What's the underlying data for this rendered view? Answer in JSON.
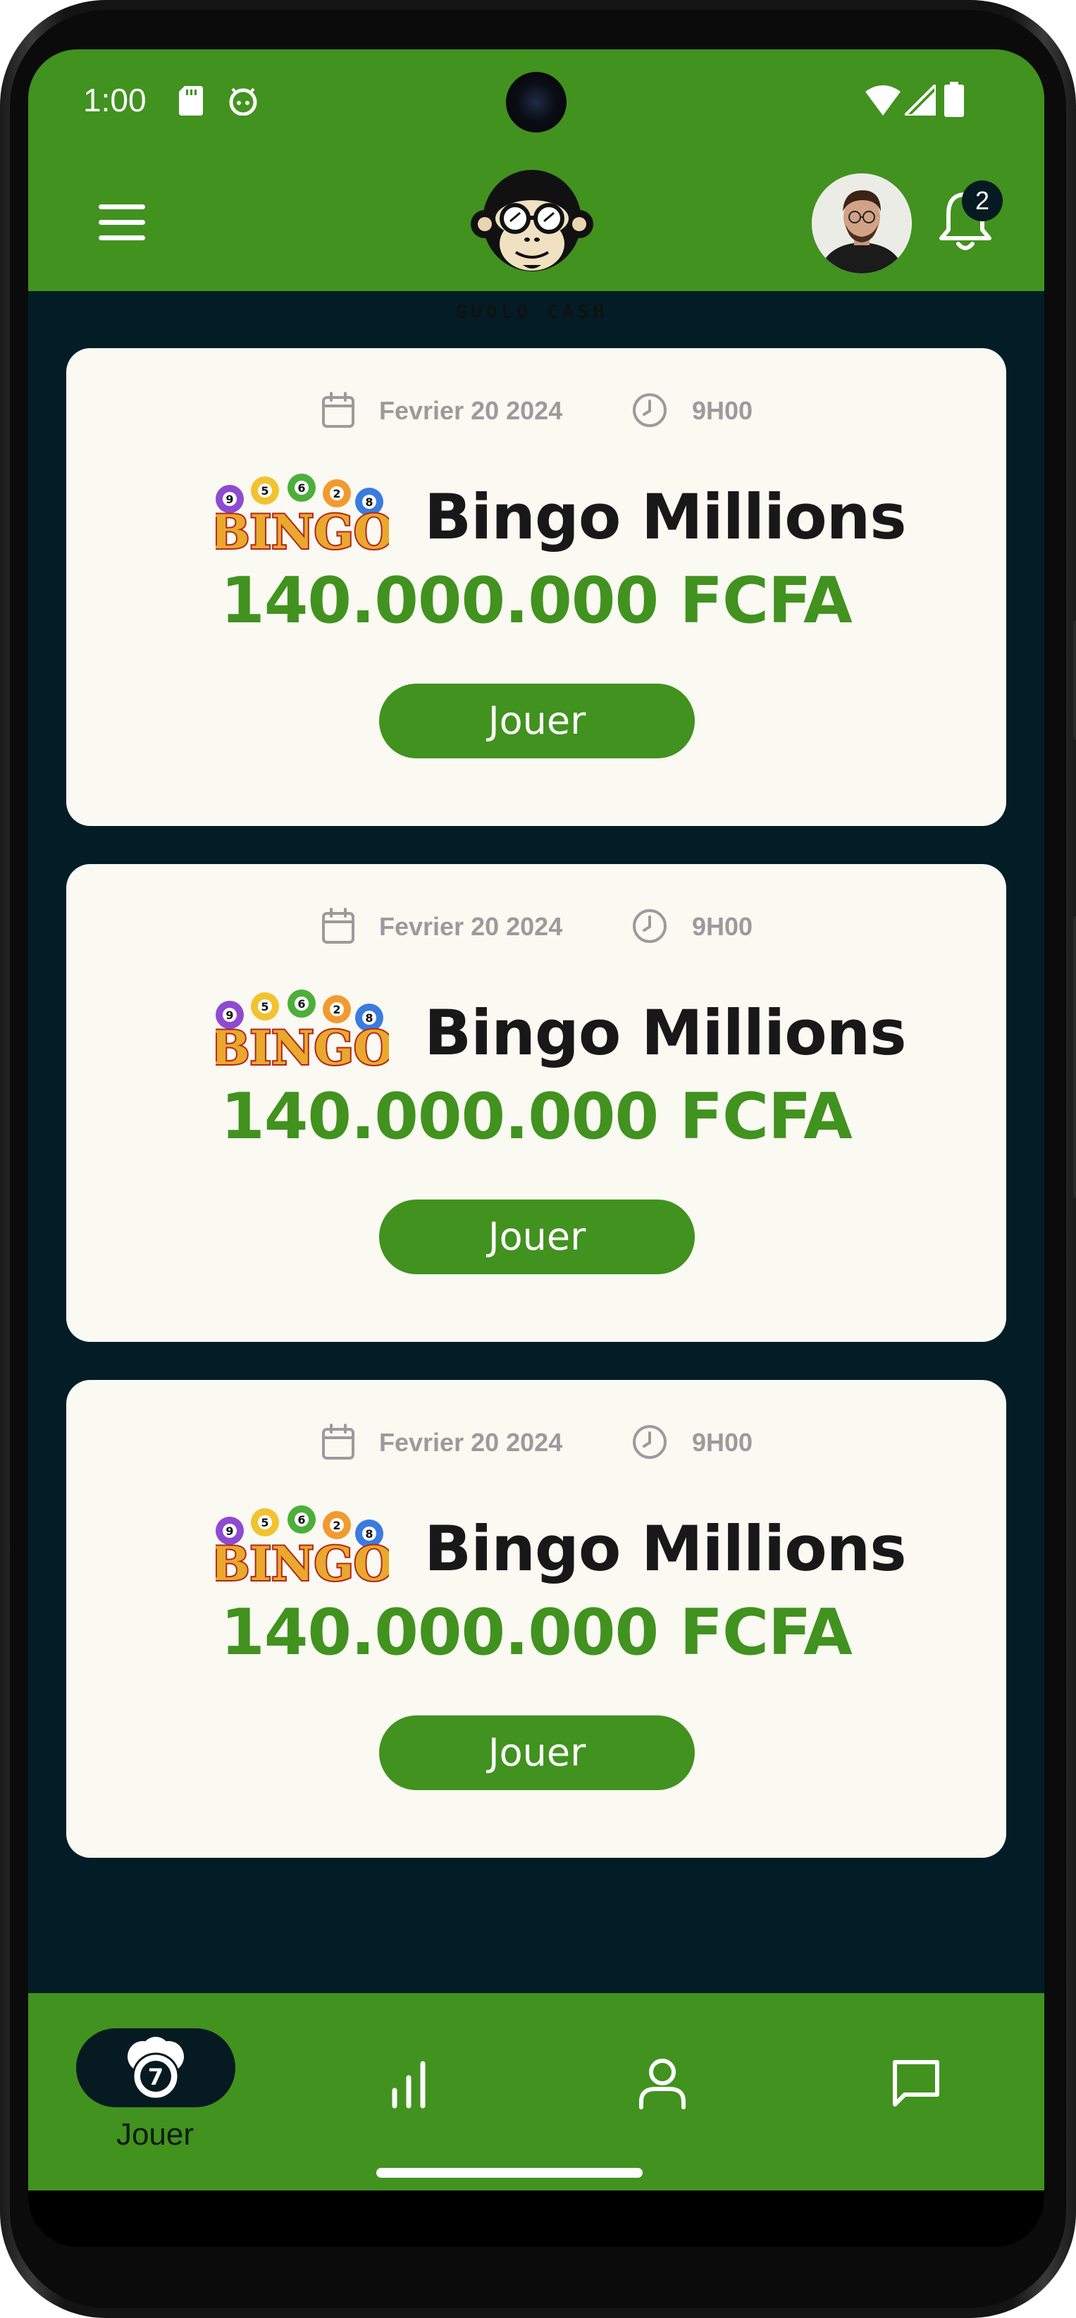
{
  "status_bar": {
    "time": "1:00",
    "icons": [
      "sd-card-icon",
      "android-icon",
      "wifi-icon",
      "signal-icon",
      "battery-icon"
    ]
  },
  "header": {
    "logo_text": "GUOLO CASH",
    "notification_count": "2",
    "icons": [
      "menu-icon",
      "avatar",
      "bell-icon"
    ]
  },
  "cards": [
    {
      "date": "Fevrier 20 2024",
      "time": "9H00",
      "title": "Bingo Millions",
      "prize": "140.000.000 FCFA",
      "button": "Jouer"
    },
    {
      "date": "Fevrier 20 2024",
      "time": "9H00",
      "title": "Bingo Millions",
      "prize": "140.000.000 FCFA",
      "button": "Jouer"
    },
    {
      "date": "Fevrier 20 2024",
      "time": "9H00",
      "title": "Bingo Millions",
      "prize": "140.000.000 FCFA",
      "button": "Jouer"
    }
  ],
  "bingo_logo_text": "BINGO",
  "bingo_ball_numbers": [
    "9",
    "5",
    "6",
    "2",
    "8"
  ],
  "bottom_nav": {
    "items": [
      {
        "label": "Jouer",
        "icon": "lottery-ball-icon",
        "active": true
      },
      {
        "label": "",
        "icon": "bar-chart-icon",
        "active": false
      },
      {
        "label": "",
        "icon": "user-icon",
        "active": false
      },
      {
        "label": "",
        "icon": "chat-icon",
        "active": false
      }
    ]
  },
  "colors": {
    "primary_green": "#41921f",
    "background_dark": "#031d26",
    "card_background": "#faf9f2",
    "title_text": "#181818",
    "meta_text": "#9b9b9b"
  }
}
